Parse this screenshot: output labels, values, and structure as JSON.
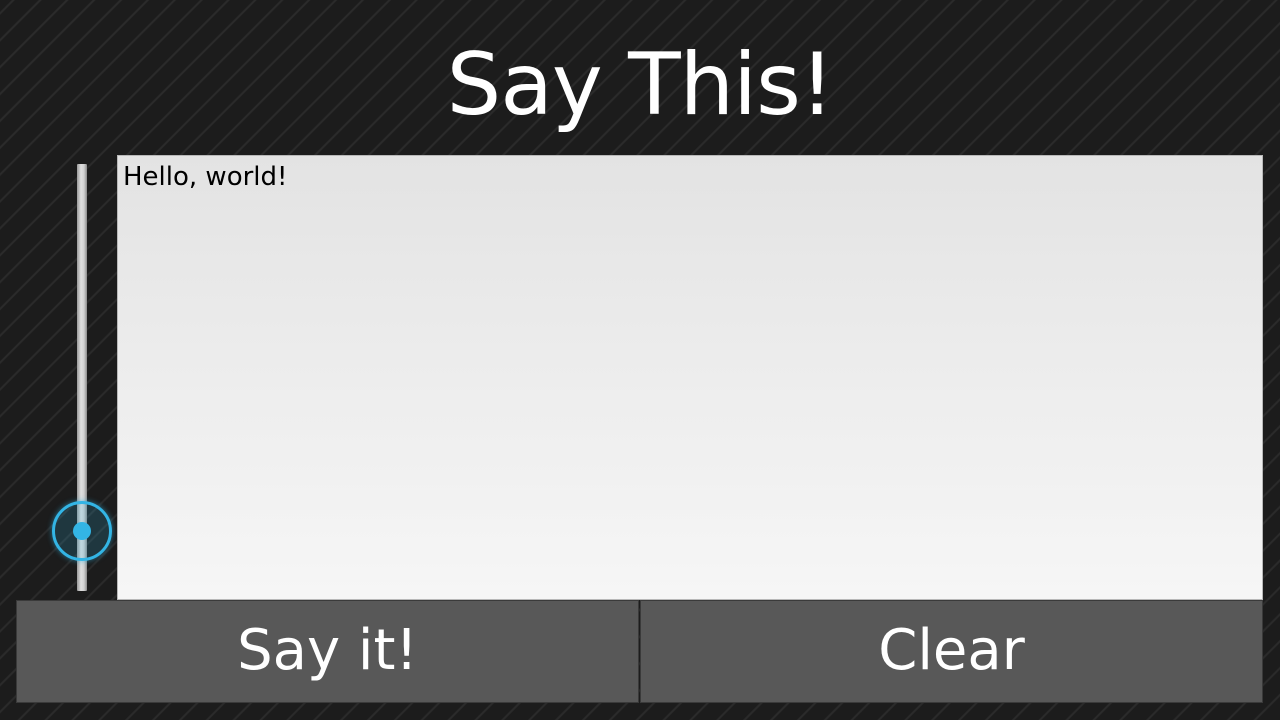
{
  "app": {
    "title": "Say This!"
  },
  "speech_input": {
    "value": "Hello, world!",
    "placeholder": ""
  },
  "slider": {
    "level_fraction": 0.14,
    "accent_color": "#33b5e5"
  },
  "buttons": {
    "say_label": "Say it!",
    "clear_label": "Clear"
  }
}
